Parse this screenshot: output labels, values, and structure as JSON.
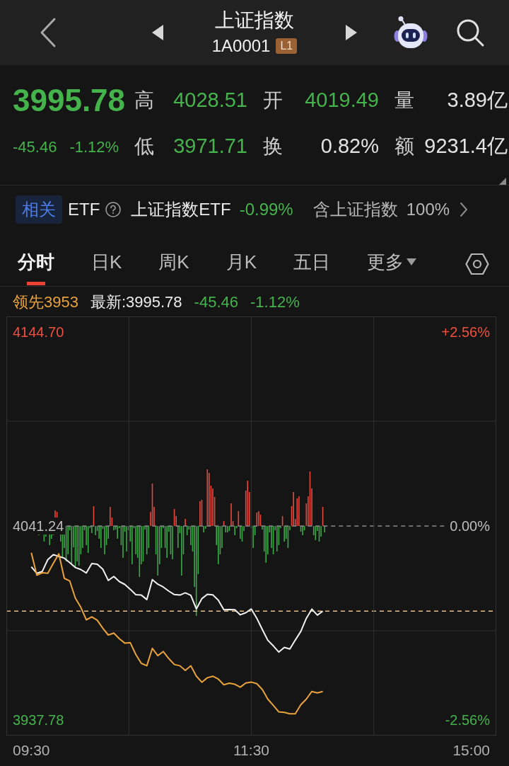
{
  "header": {
    "title": "上证指数",
    "code": "1A0001",
    "level_badge": "L1"
  },
  "quote": {
    "price": "3995.78",
    "change": "-45.46",
    "change_pct": "-1.12%",
    "falling": true,
    "stats": [
      {
        "label": "高",
        "value": "4028.51",
        "falling": true
      },
      {
        "label": "开",
        "value": "4019.49",
        "falling": true
      },
      {
        "label": "量",
        "value": "3.89亿",
        "falling": false
      },
      {
        "label": "低",
        "value": "3971.71",
        "falling": true
      },
      {
        "label": "换",
        "value": "0.82%",
        "falling": false
      },
      {
        "label": "额",
        "value": "9231.4亿",
        "falling": false
      }
    ]
  },
  "related_etf": {
    "tag": "相关",
    "label": "ETF",
    "name": "上证指数ETF",
    "change": "-0.99%",
    "falling": true,
    "holding_label": "含上证指数",
    "holding": "100%"
  },
  "tabs": [
    {
      "label": "分时",
      "kind": "view",
      "selected": true
    },
    {
      "label": "日K",
      "kind": "view",
      "selected": false
    },
    {
      "label": "周K",
      "kind": "view",
      "selected": false
    },
    {
      "label": "月K",
      "kind": "view",
      "selected": false
    },
    {
      "label": "五日",
      "kind": "view",
      "selected": false
    },
    {
      "label": "更多",
      "kind": "menu",
      "selected": false
    }
  ],
  "legend": {
    "leading": "领先3953",
    "latest": "最新:3995.78",
    "change": "-45.46",
    "change_pct": "-1.12%",
    "falling": true
  },
  "chart": {
    "chart_data": {
      "type": "line",
      "categories": [
        "09:30",
        null,
        null,
        null,
        null,
        null,
        null,
        null,
        null,
        null,
        null,
        null,
        null,
        null,
        null,
        null,
        null,
        null,
        null,
        null,
        null,
        null,
        null,
        null,
        null,
        null,
        null,
        null,
        null,
        null,
        null,
        null,
        null,
        null,
        null,
        null,
        null,
        null,
        null,
        null,
        "11:30",
        null,
        null,
        null,
        null,
        null,
        null,
        null,
        null,
        null,
        null,
        null,
        null,
        null,
        null,
        null,
        null,
        null,
        null,
        null,
        null,
        null,
        null,
        null,
        null,
        null,
        null,
        null,
        null,
        null,
        null,
        null,
        null,
        null,
        null,
        null,
        null,
        null,
        null,
        null,
        "15:00"
      ],
      "series": [
        {
          "color": "#f2f2f2",
          "values": [
            4019.5,
            4016.0,
            4017.0,
            4023.3,
            4026.0,
            4025.0,
            4024.1,
            4021.7,
            4019.1,
            4018.0,
            4016.2,
            4021.2,
            4020.8,
            4018.2,
            4012.2,
            4014.3,
            4011.6,
            4010.1,
            4007.5,
            4004.6,
            4004.4,
            4002.0,
            4012.6,
            4010.2,
            4008.7,
            4006.5,
            4004.7,
            4004.4,
            4005.6,
            4004.3,
            3997.0,
            4002.5,
            4004.8,
            4004.5,
            4001.7,
            3996.6,
            3996.7,
            3996.6,
            3993.9,
            3995.0,
            3997.0,
            3992.0,
            3986.0,
            3980.3,
            3977.3,
            3974.0,
            3976.5,
            3975.6,
            3980.4,
            3985.0,
            3992.0,
            3996.9,
            3993.7,
            3995.8,
            null,
            null,
            null,
            null,
            null,
            null,
            null,
            null,
            null,
            null,
            null,
            null,
            null,
            null,
            null,
            null,
            null,
            null,
            null,
            null,
            null,
            null,
            null,
            null,
            null,
            null,
            null
          ]
        },
        {
          "color": "#e9a23c",
          "values": [
            4027.0,
            4015.0,
            4016.3,
            4016.0,
            4021.3,
            4026.4,
            4013.3,
            4011.9,
            4002.8,
            3997.9,
            3991.2,
            3992.8,
            3991.0,
            3986.7,
            3983.1,
            3984.1,
            3981.1,
            3978.8,
            3979.0,
            3972.7,
            3968.0,
            3966.7,
            3976.0,
            3972.1,
            3974.3,
            3970.5,
            3967.4,
            3966.7,
            3964.2,
            3966.7,
            3961.2,
            3957.9,
            3960.3,
            3961.1,
            3959.6,
            3956.6,
            3957.4,
            3956.8,
            3955.3,
            3957.5,
            3958.0,
            3957.1,
            3954.0,
            3948.9,
            3945.6,
            3942.1,
            3941.8,
            3941.1,
            3941.1,
            3945.9,
            3948.9,
            3953.0,
            3952.2,
            3953.0,
            null,
            null,
            null,
            null,
            null,
            null,
            null,
            null,
            null,
            null,
            null,
            null,
            null,
            null,
            null,
            null,
            null,
            null,
            null,
            null,
            null,
            null,
            null,
            null,
            null,
            null,
            null
          ]
        }
      ],
      "ylim": [
        3929.47,
        4153.01
      ],
      "yticks": [
        {
          "value": 4144.7,
          "label": "4144.70"
        },
        {
          "value": 4041.24,
          "label": "4041.24"
        },
        {
          "value": 3937.78,
          "label": "3937.78"
        }
      ]
    },
    "right_labels": [
      "+2.56%",
      "0.00%",
      "-2.56%"
    ]
  }
}
